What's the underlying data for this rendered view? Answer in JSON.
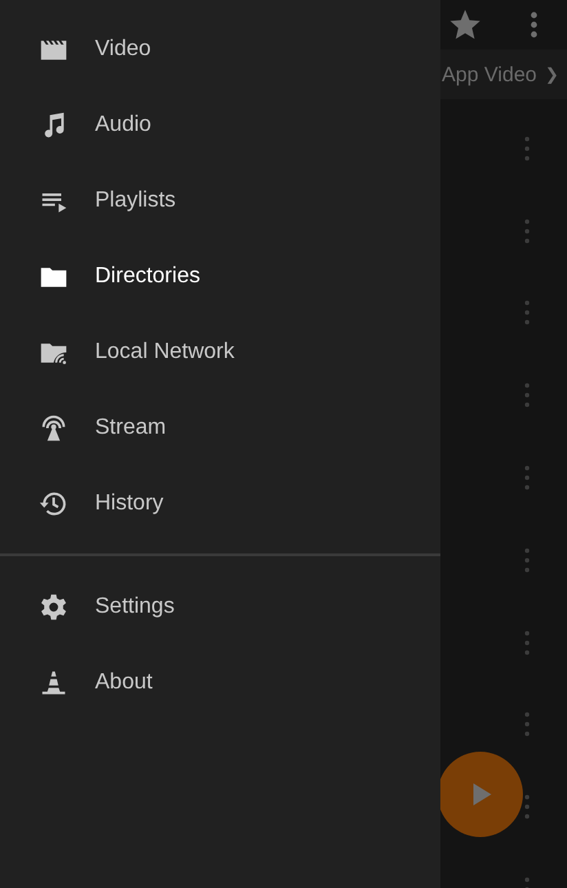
{
  "drawer": {
    "items": [
      {
        "label": "Video",
        "selected": false
      },
      {
        "label": "Audio",
        "selected": false
      },
      {
        "label": "Playlists",
        "selected": false
      },
      {
        "label": "Directories",
        "selected": true
      },
      {
        "label": "Local Network",
        "selected": false
      },
      {
        "label": "Stream",
        "selected": false
      },
      {
        "label": "History",
        "selected": false
      }
    ],
    "footer_items": [
      {
        "label": "Settings",
        "selected": false
      },
      {
        "label": "About",
        "selected": false
      }
    ]
  },
  "background": {
    "breadcrumb": "App Video",
    "chevron": "❯"
  }
}
